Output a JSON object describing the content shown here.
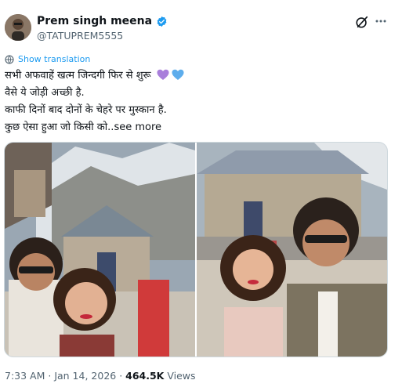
{
  "author": {
    "name": "Prem singh meena",
    "handle": "@TATUPREM5555",
    "verified_color": "#1d9bf0"
  },
  "header_icons": [
    "grok-icon",
    "more-options-icon"
  ],
  "translate": {
    "label": "Show translation",
    "icon": "globe-icon"
  },
  "tweet": {
    "lines": [
      "सभी अफवाहें खत्म जिन्दगी फिर से शुरू",
      "वैसे ये जोड़ी अच्छी है.",
      "काफी दिनों बाद दोनों के चेहरे पर मुस्कान है.",
      "कुछ ऐसा हुआ जो किसी को.."
    ],
    "emoji": [
      "purple-heart",
      "blue-heart"
    ],
    "see_more": "see more"
  },
  "media": {
    "count": 2,
    "photos": [
      "selfie-at-kedarnath-temple-mountains",
      "selfie-in-front-of-kedarnath-temple"
    ]
  },
  "meta": {
    "time": "7:33 AM",
    "separator": " · ",
    "date": "Jan 14, 2026",
    "views_count": "464.5K",
    "views_label": "Views"
  },
  "colors": {
    "accent": "#1d9bf0",
    "text": "#0f1419",
    "secondary": "#536471",
    "border": "#cfd9de"
  }
}
